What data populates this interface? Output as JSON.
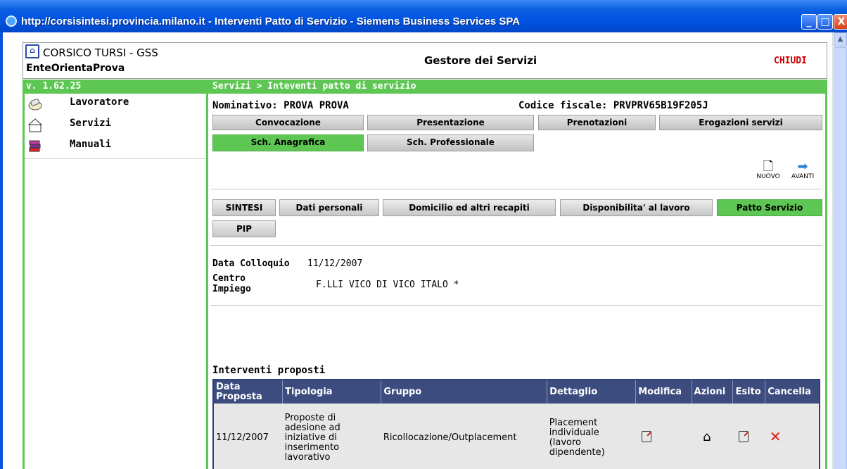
{
  "window": {
    "title": "http://corsisintesi.provincia.milano.it - Interventi Patto di Servizio - Siemens Business Services SPA",
    "min": "_",
    "max": "□",
    "close": "X"
  },
  "header": {
    "org": "CORSICO TURSI - GSS",
    "ente": "EnteOrientaProva",
    "app": "Gestore dei Servizi",
    "chiudi": "CHIUDI"
  },
  "bar": {
    "version": "v. 1.62.25",
    "breadcrumb": "Servizi > Inteventi patto di servizio"
  },
  "sidebar": {
    "items": [
      {
        "label": "Lavoratore",
        "icon": "worker-icon"
      },
      {
        "label": "Servizi",
        "icon": "services-icon"
      },
      {
        "label": "Manuali",
        "icon": "books-icon"
      }
    ]
  },
  "person": {
    "nominativo": "Nominativo: PROVA  PROVA",
    "codice": "Codice fiscale: PRVPRV65B19F205J"
  },
  "tabs_top": [
    "Convocazione",
    "Presentazione",
    "Prenotazioni",
    "Erogazioni servizi"
  ],
  "tabs_second": [
    "Sch. Anagrafica",
    "Sch. Professionale"
  ],
  "actions": {
    "nuovo": "NUOVO",
    "avanti": "AVANTI"
  },
  "subtabs": [
    "SINTESI",
    "Dati personali",
    "Domicilio ed altri recapiti",
    "Disponibilita' al lavoro",
    "Patto Servizio",
    "PIP"
  ],
  "fields": {
    "data_colloquio_label": "Data Colloquio",
    "data_colloquio_value": "11/12/2007",
    "centro_label_1": "Centro",
    "centro_label_2": "Impiego",
    "centro_value": "F.LLI VICO DI VICO ITALO *"
  },
  "interventi": {
    "title": "Interventi proposti",
    "columns": [
      "Data Proposta",
      "Tipologia",
      "Gruppo",
      "Dettaglio",
      "Modifica",
      "Azioni",
      "Esito",
      "Cancella"
    ],
    "rows": [
      {
        "data": "11/12/2007",
        "tipologia": "Proposte di adesione ad iniziative di inserimento lavorativo",
        "gruppo": "Ricollocazione/Outplacement",
        "dettaglio": "Placement individuale (lavoro dipendente)"
      }
    ]
  },
  "colors": {
    "accent_green": "#5ec753",
    "table_header": "#3c4c7e",
    "chiudi_red": "#cc0000"
  }
}
